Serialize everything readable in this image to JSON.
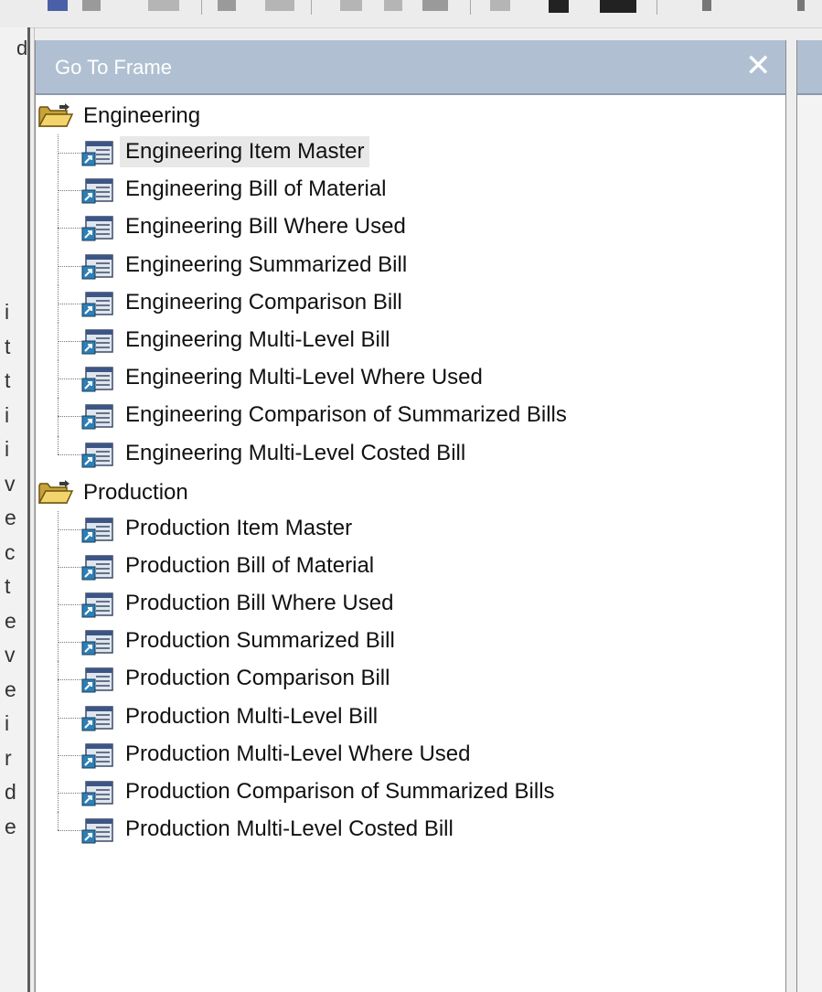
{
  "left_panel": {
    "top_char": "d",
    "fragments": [
      "i",
      "t",
      "t",
      "i",
      "i",
      "v",
      "e",
      "c",
      "t",
      "e",
      "v",
      "e",
      "i",
      "r",
      "d",
      "e"
    ]
  },
  "go_to_frame": {
    "title": "Go To Frame",
    "close_icon": "close-icon",
    "groups": [
      {
        "label": "Engineering",
        "icon": "open-folder-icon",
        "items": [
          {
            "label": "Engineering Item Master",
            "selected": true
          },
          {
            "label": "Engineering Bill of Material"
          },
          {
            "label": "Engineering Bill Where Used"
          },
          {
            "label": "Engineering Summarized Bill"
          },
          {
            "label": "Engineering Comparison Bill"
          },
          {
            "label": "Engineering Multi-Level Bill"
          },
          {
            "label": "Engineering Multi-Level Where Used"
          },
          {
            "label": "Engineering Comparison of Summarized Bills"
          },
          {
            "label": "Engineering Multi-Level Costed Bill"
          }
        ]
      },
      {
        "label": "Production",
        "icon": "open-folder-icon",
        "items": [
          {
            "label": "Production Item Master"
          },
          {
            "label": "Production Bill of Material"
          },
          {
            "label": "Production Bill Where Used"
          },
          {
            "label": "Production Summarized Bill"
          },
          {
            "label": "Production Comparison Bill"
          },
          {
            "label": "Production Multi-Level Bill"
          },
          {
            "label": "Production Multi-Level Where Used"
          },
          {
            "label": "Production Comparison of Summarized Bills"
          },
          {
            "label": "Production Multi-Level Costed Bill"
          }
        ]
      }
    ]
  },
  "colors": {
    "title_bar": "#b0c0d2",
    "title_text": "#ffffff",
    "selection": "#e8e8e8"
  }
}
